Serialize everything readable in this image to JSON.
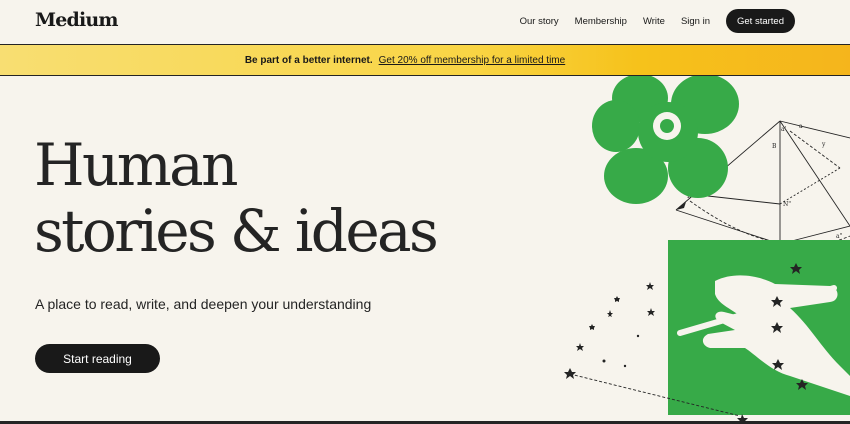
{
  "header": {
    "logo": "Medium",
    "nav": [
      {
        "label": "Our story"
      },
      {
        "label": "Membership"
      },
      {
        "label": "Write"
      },
      {
        "label": "Sign in"
      }
    ],
    "cta_label": "Get started"
  },
  "banner": {
    "text": "Be part of a better internet.",
    "link": "Get 20% off membership for a limited time"
  },
  "hero": {
    "title_line1": "Human",
    "title_line2": "stories & ideas",
    "subtitle": "A place to read, write, and deepen your understanding",
    "cta_label": "Start reading"
  },
  "illustration": {
    "green": "#37aa48",
    "diagram_labels": [
      "a'",
      "B",
      "B'",
      "N\"",
      "E",
      "a",
      "a\"",
      "y"
    ]
  }
}
